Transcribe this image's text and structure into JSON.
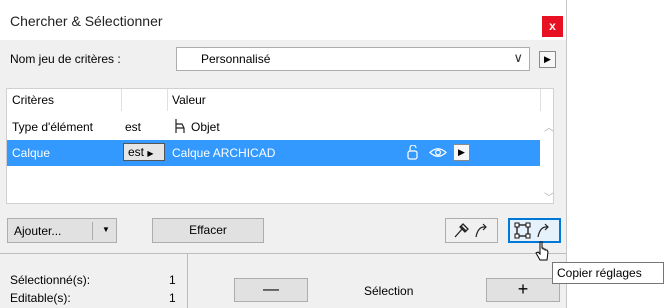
{
  "window": {
    "title": "Chercher & Sélectionner",
    "close_label": "x"
  },
  "criteria_set": {
    "label": "Nom jeu de critères :",
    "value": "Personnalisé",
    "chevron": "∨",
    "arrow": "▶"
  },
  "table": {
    "headers": {
      "criteria": "Critères",
      "value": "Valeur"
    },
    "rows": [
      {
        "criteria": "Type d'élément",
        "operator": "est",
        "icon": "chair-icon",
        "value": "Objet",
        "selected": false
      },
      {
        "criteria": "Calque",
        "operator": "est",
        "operator_arrow": "▶",
        "value": "Calque ARCHICAD",
        "selected": true,
        "arrow": "▶"
      }
    ]
  },
  "toolbar": {
    "add_label": "Ajouter...",
    "add_dropdown": "▼",
    "clear_label": "Effacer"
  },
  "tooltip": {
    "text": "Copier réglages"
  },
  "status": {
    "selected_label": "Sélectionné(s):",
    "selected_count": "1",
    "editable_label": "Editable(s):",
    "editable_count": "1"
  },
  "selection": {
    "minus_label": "—",
    "label": "Sélection",
    "plus_label": "+"
  },
  "colors": {
    "selection": "#3399ff",
    "close": "#e81123",
    "accent": "#0078d7"
  }
}
